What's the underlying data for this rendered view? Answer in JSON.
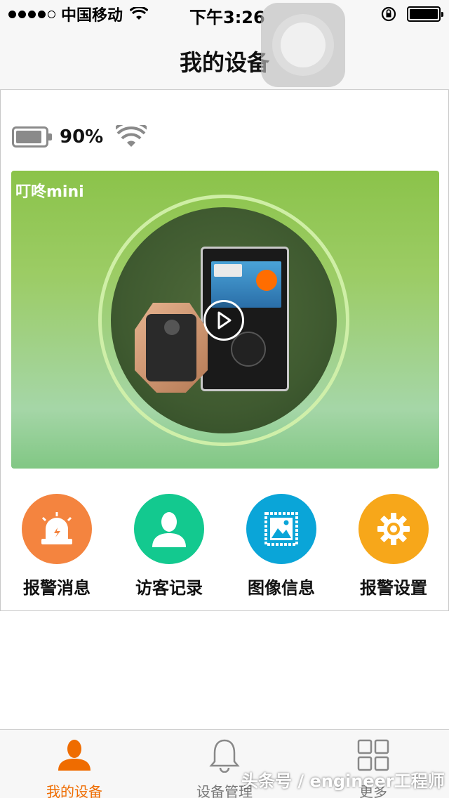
{
  "status_bar": {
    "carrier": "中国移动",
    "time": "下午3:26",
    "signal_bars": 4,
    "signal_max": 5
  },
  "nav": {
    "title": "我的设备"
  },
  "device": {
    "battery_percent": "90%",
    "battery_level": 0.9,
    "name": "叮咚mini"
  },
  "actions": [
    {
      "label": "报警消息",
      "icon": "alarm-light-icon",
      "color": "#f4843f"
    },
    {
      "label": "访客记录",
      "icon": "person-icon",
      "color": "#13c98f"
    },
    {
      "label": "图像信息",
      "icon": "image-icon",
      "color": "#0aa5d8"
    },
    {
      "label": "报警设置",
      "icon": "gear-icon",
      "color": "#f7a71a"
    }
  ],
  "tabs": [
    {
      "label": "我的设备",
      "icon": "person-icon",
      "active": true
    },
    {
      "label": "设备管理",
      "icon": "bell-icon",
      "active": false
    },
    {
      "label": "更多",
      "icon": "grid-icon",
      "active": false
    }
  ],
  "colors": {
    "accent": "#ef6c00",
    "video_bg": "#8bc34a"
  },
  "watermark": "头条号 / engineer工程师"
}
